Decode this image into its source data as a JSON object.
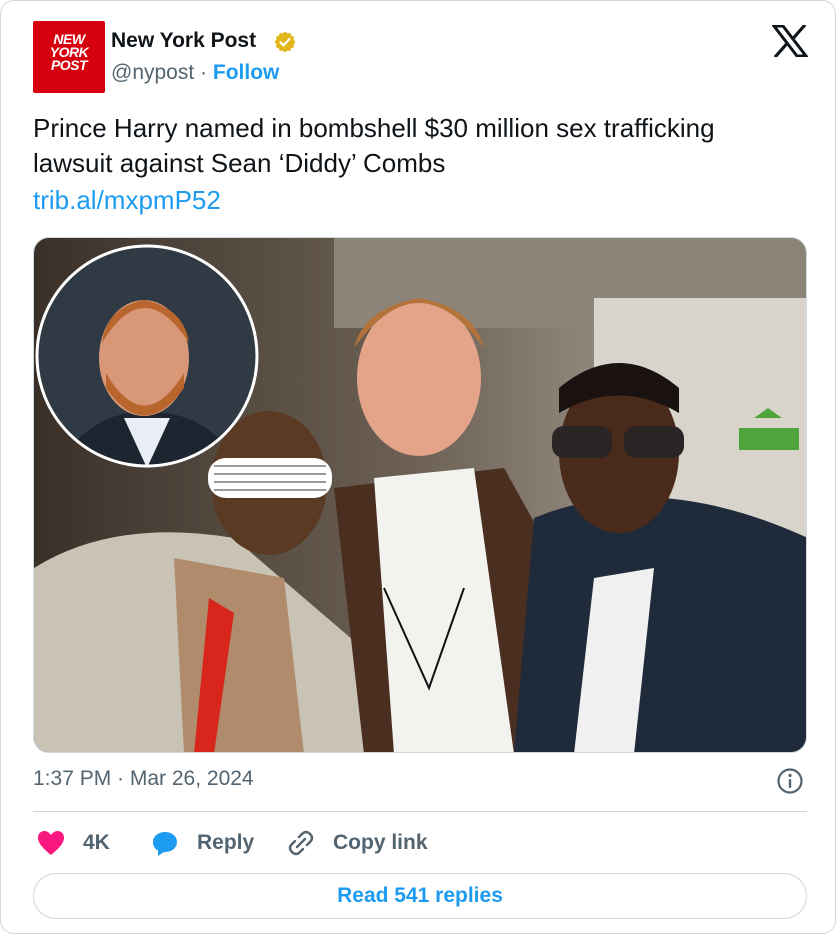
{
  "account": {
    "display_name": "New York Post",
    "handle": "@nypost",
    "separator": "·",
    "follow_label": "Follow",
    "avatar_text": [
      "NEW",
      "YORK",
      "POST"
    ]
  },
  "tweet": {
    "text": "Prince Harry named in bombshell $30 million sex trafficking lawsuit against Sean ‘Diddy’ Combs",
    "link": "trib.al/mxpmP52",
    "timestamp": "1:37 PM · Mar 26, 2024"
  },
  "actions": {
    "like_count": "4K",
    "reply_label": "Reply",
    "copy_label": "Copy link"
  },
  "footer": {
    "read_replies_label": "Read 541 replies"
  },
  "colors": {
    "accent": "#1d9bf0",
    "like": "#f91880",
    "verified": "#e2b719",
    "brand_red": "#d6000f"
  },
  "icons": [
    "verified-badge-icon",
    "x-logo-icon",
    "info-icon",
    "heart-icon",
    "reply-bubble-icon",
    "link-icon"
  ]
}
